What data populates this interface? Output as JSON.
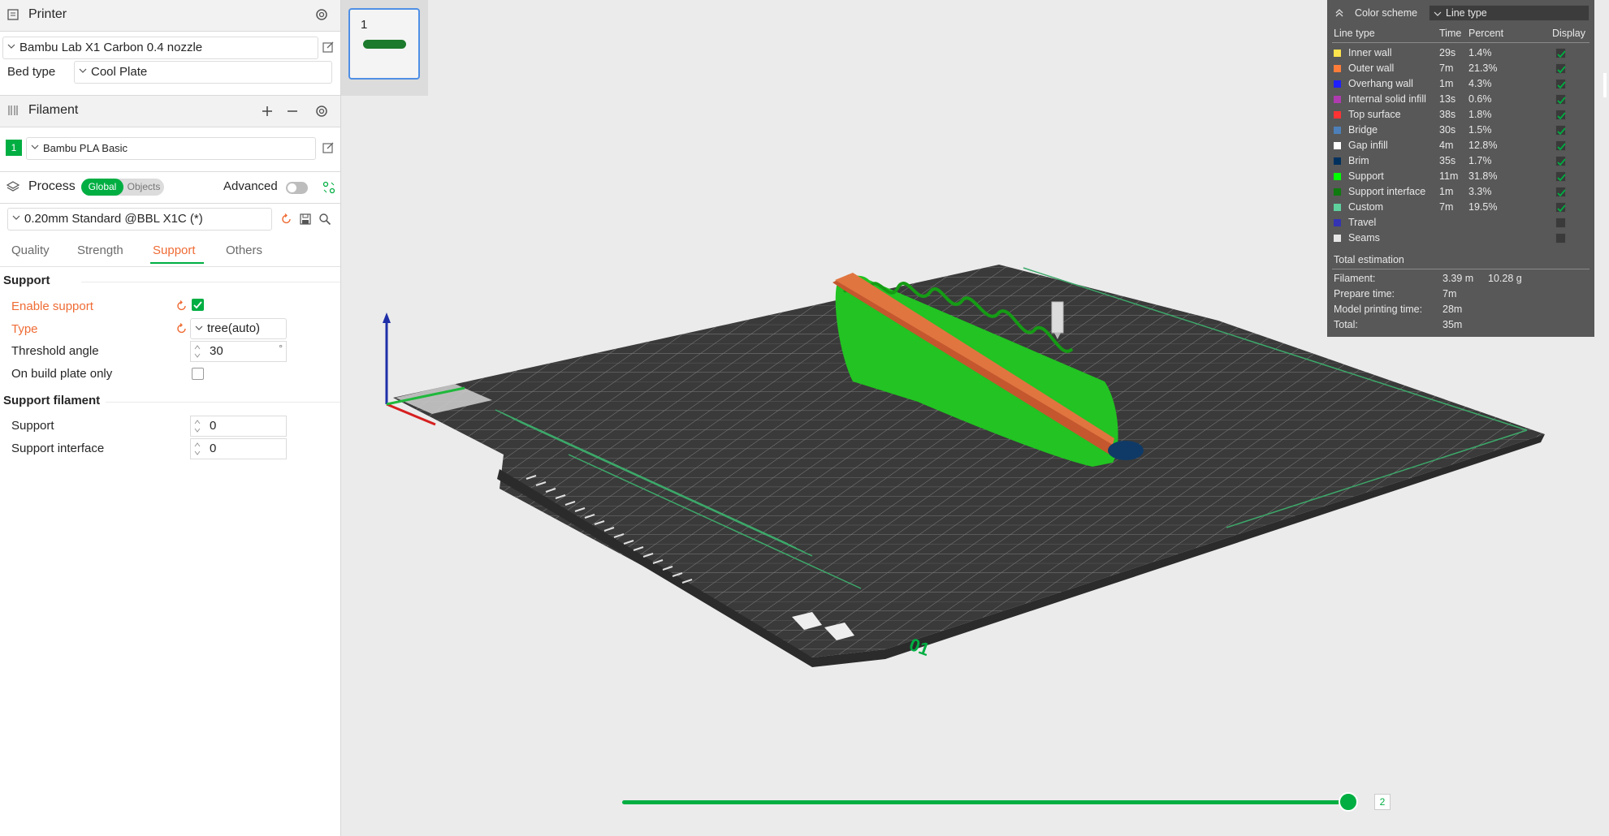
{
  "printer": {
    "title": "Printer",
    "preset": "Bambu Lab X1 Carbon 0.4 nozzle",
    "bed_type_label": "Bed type",
    "bed_type": "Cool Plate"
  },
  "filament": {
    "title": "Filament",
    "slot_number": "1",
    "preset": "Bambu PLA Basic",
    "slot_color": "#00ae42"
  },
  "process": {
    "title": "Process",
    "toggle_global": "Global",
    "toggle_objects": "Objects",
    "advanced_label": "Advanced",
    "preset": "0.20mm Standard @BBL X1C (*)",
    "tabs": [
      "Quality",
      "Strength",
      "Support",
      "Others"
    ],
    "active_tab": "Support"
  },
  "support": {
    "group_title": "Support",
    "enable_support_label": "Enable support",
    "enable_support_checked": true,
    "type_label": "Type",
    "type_value": "tree(auto)",
    "threshold_label": "Threshold angle",
    "threshold_value": "30",
    "threshold_unit": "°",
    "build_plate_only_label": "On build plate only",
    "build_plate_only_checked": false
  },
  "support_filament": {
    "group_title": "Support filament",
    "support_label": "Support",
    "support_value": "0",
    "interface_label": "Support interface",
    "interface_value": "0"
  },
  "plate_thumbnail": {
    "number": "1"
  },
  "legend": {
    "color_scheme_label": "Color scheme",
    "color_scheme_value": "Line type",
    "col_line_type": "Line type",
    "col_time": "Time",
    "col_percent": "Percent",
    "col_display": "Display",
    "rows": [
      {
        "name": "Inner wall",
        "time": "29s",
        "percent": "1.4%",
        "color": "#ffe34d",
        "display": true
      },
      {
        "name": "Outer wall",
        "time": "7m",
        "percent": "21.3%",
        "color": "#ff7d38",
        "display": true
      },
      {
        "name": "Overhang wall",
        "time": "1m",
        "percent": "4.3%",
        "color": "#1f1fff",
        "display": true
      },
      {
        "name": "Internal solid infill",
        "time": "13s",
        "percent": "0.6%",
        "color": "#b03bb0",
        "display": true
      },
      {
        "name": "Top surface",
        "time": "38s",
        "percent": "1.8%",
        "color": "#ff3333",
        "display": true
      },
      {
        "name": "Bridge",
        "time": "30s",
        "percent": "1.5%",
        "color": "#4d80ba",
        "display": true
      },
      {
        "name": "Gap infill",
        "time": "4m",
        "percent": "12.8%",
        "color": "#ffffff",
        "display": true
      },
      {
        "name": "Brim",
        "time": "35s",
        "percent": "1.7%",
        "color": "#00305e",
        "display": true
      },
      {
        "name": "Support",
        "time": "11m",
        "percent": "31.8%",
        "color": "#00ff00",
        "display": true
      },
      {
        "name": "Support interface",
        "time": "1m",
        "percent": "3.3%",
        "color": "#0f7a0f",
        "display": true
      },
      {
        "name": "Custom",
        "time": "7m",
        "percent": "19.5%",
        "color": "#5ed19d",
        "display": true
      },
      {
        "name": "Travel",
        "time": "",
        "percent": "",
        "color": "#3333b3",
        "display": false
      },
      {
        "name": "Seams",
        "time": "",
        "percent": "",
        "color": "#e6e6e6",
        "display": false
      }
    ],
    "total_estimation_label": "Total estimation",
    "filament_label": "Filament:",
    "filament_length": "3.39 m",
    "filament_weight": "10.28 g",
    "prepare_label": "Prepare time:",
    "prepare_value": "7m",
    "model_print_label": "Model printing time:",
    "model_print_value": "28m",
    "total_label": "Total:",
    "total_value": "35m"
  },
  "plate": {
    "plate_label": "01"
  },
  "layer_slider": {
    "value": "2",
    "position": 1.0
  }
}
